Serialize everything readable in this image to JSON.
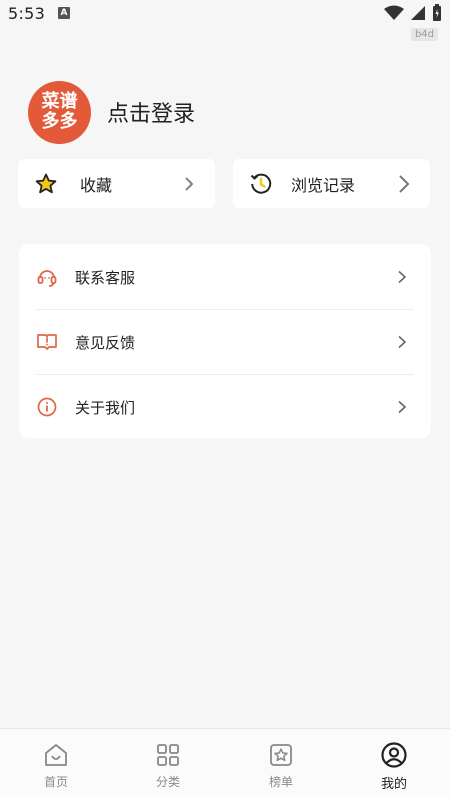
{
  "status_bar": {
    "time": "5:53",
    "notif_icon": "A",
    "badge": "b4d"
  },
  "profile": {
    "avatar_line1": "菜谱",
    "avatar_line2": "多多",
    "login_label": "点击登录",
    "avatar_color": "#e25a3a"
  },
  "quick_cards": {
    "favorites": {
      "label": "收藏",
      "icon": "star-icon"
    },
    "history": {
      "label": "浏览记录",
      "icon": "clock-history-icon"
    }
  },
  "menu": {
    "items": [
      {
        "label": "联系客服",
        "icon": "headset-icon"
      },
      {
        "label": "意见反馈",
        "icon": "feedback-book-icon"
      },
      {
        "label": "关于我们",
        "icon": "info-icon"
      }
    ],
    "icon_color": "#e0664a"
  },
  "bottom_nav": {
    "items": [
      {
        "label": "首页",
        "icon": "home-icon"
      },
      {
        "label": "分类",
        "icon": "grid-icon"
      },
      {
        "label": "榜单",
        "icon": "ranking-star-icon"
      },
      {
        "label": "我的",
        "icon": "user-icon",
        "active": true
      }
    ]
  }
}
